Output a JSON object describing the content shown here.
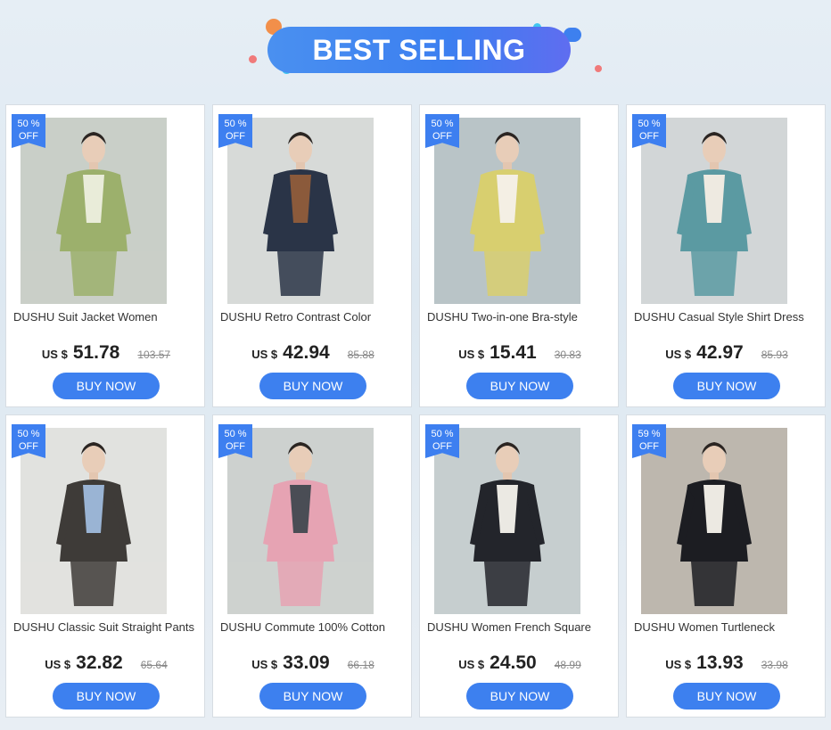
{
  "banner": {
    "title": "BEST SELLING",
    "colors": {
      "pill": "#3c7ff0",
      "orange": "#f28f4a",
      "cyan": "#3fc6f0",
      "pink": "#f07a7a"
    }
  },
  "products": [
    {
      "discount_top": "50 %",
      "discount_bottom": "OFF",
      "title": "DUSHU Suit Jacket Women",
      "currency": "US $",
      "price": "51.78",
      "old_price": "103.57",
      "buy_label": "BUY NOW",
      "image": {
        "bg": "#c9cfc8",
        "outfit": "#9cb06c",
        "accent": "#e9ecd9"
      }
    },
    {
      "discount_top": "50 %",
      "discount_bottom": "OFF",
      "title": "DUSHU Retro Contrast Color",
      "currency": "US $",
      "price": "42.94",
      "old_price": "85.88",
      "buy_label": "BUY NOW",
      "image": {
        "bg": "#d7dad8",
        "outfit": "#2a3447",
        "accent": "#8b5a3b"
      }
    },
    {
      "discount_top": "50 %",
      "discount_bottom": "OFF",
      "title": "DUSHU Two-in-one Bra-style",
      "currency": "US $",
      "price": "15.41",
      "old_price": "30.83",
      "buy_label": "BUY NOW",
      "image": {
        "bg": "#b9c4c7",
        "outfit": "#d8cf6f",
        "accent": "#f4efe4"
      }
    },
    {
      "discount_top": "50 %",
      "discount_bottom": "OFF",
      "title": "DUSHU Casual Style Shirt Dress",
      "currency": "US $",
      "price": "42.97",
      "old_price": "85.93",
      "buy_label": "BUY NOW",
      "image": {
        "bg": "#d2d6d7",
        "outfit": "#5b9aa2",
        "accent": "#eeeae1"
      }
    },
    {
      "discount_top": "50 %",
      "discount_bottom": "OFF",
      "title": "DUSHU Classic Suit Straight Pants",
      "currency": "US $",
      "price": "32.82",
      "old_price": "65.64",
      "buy_label": "BUY NOW",
      "image": {
        "bg": "#e1e2df",
        "outfit": "#3e3b38",
        "accent": "#9ab4d4"
      }
    },
    {
      "discount_top": "50 %",
      "discount_bottom": "OFF",
      "title": "DUSHU Commute 100% Cotton",
      "currency": "US $",
      "price": "33.09",
      "old_price": "66.18",
      "buy_label": "BUY NOW",
      "image": {
        "bg": "#cdd1cf",
        "outfit": "#e6a3b3",
        "accent": "#4a4d55"
      }
    },
    {
      "discount_top": "50 %",
      "discount_bottom": "OFF",
      "title": "DUSHU Women French Square",
      "currency": "US $",
      "price": "24.50",
      "old_price": "48.99",
      "buy_label": "BUY NOW",
      "image": {
        "bg": "#c6cecf",
        "outfit": "#23252b",
        "accent": "#ebe9e3"
      }
    },
    {
      "discount_top": "59 %",
      "discount_bottom": "OFF",
      "title": "DUSHU Women Turtleneck",
      "currency": "US $",
      "price": "13.93",
      "old_price": "33.98",
      "buy_label": "BUY NOW",
      "image": {
        "bg": "#bdb7ae",
        "outfit": "#1c1d22",
        "accent": "#ece9e2"
      }
    }
  ]
}
